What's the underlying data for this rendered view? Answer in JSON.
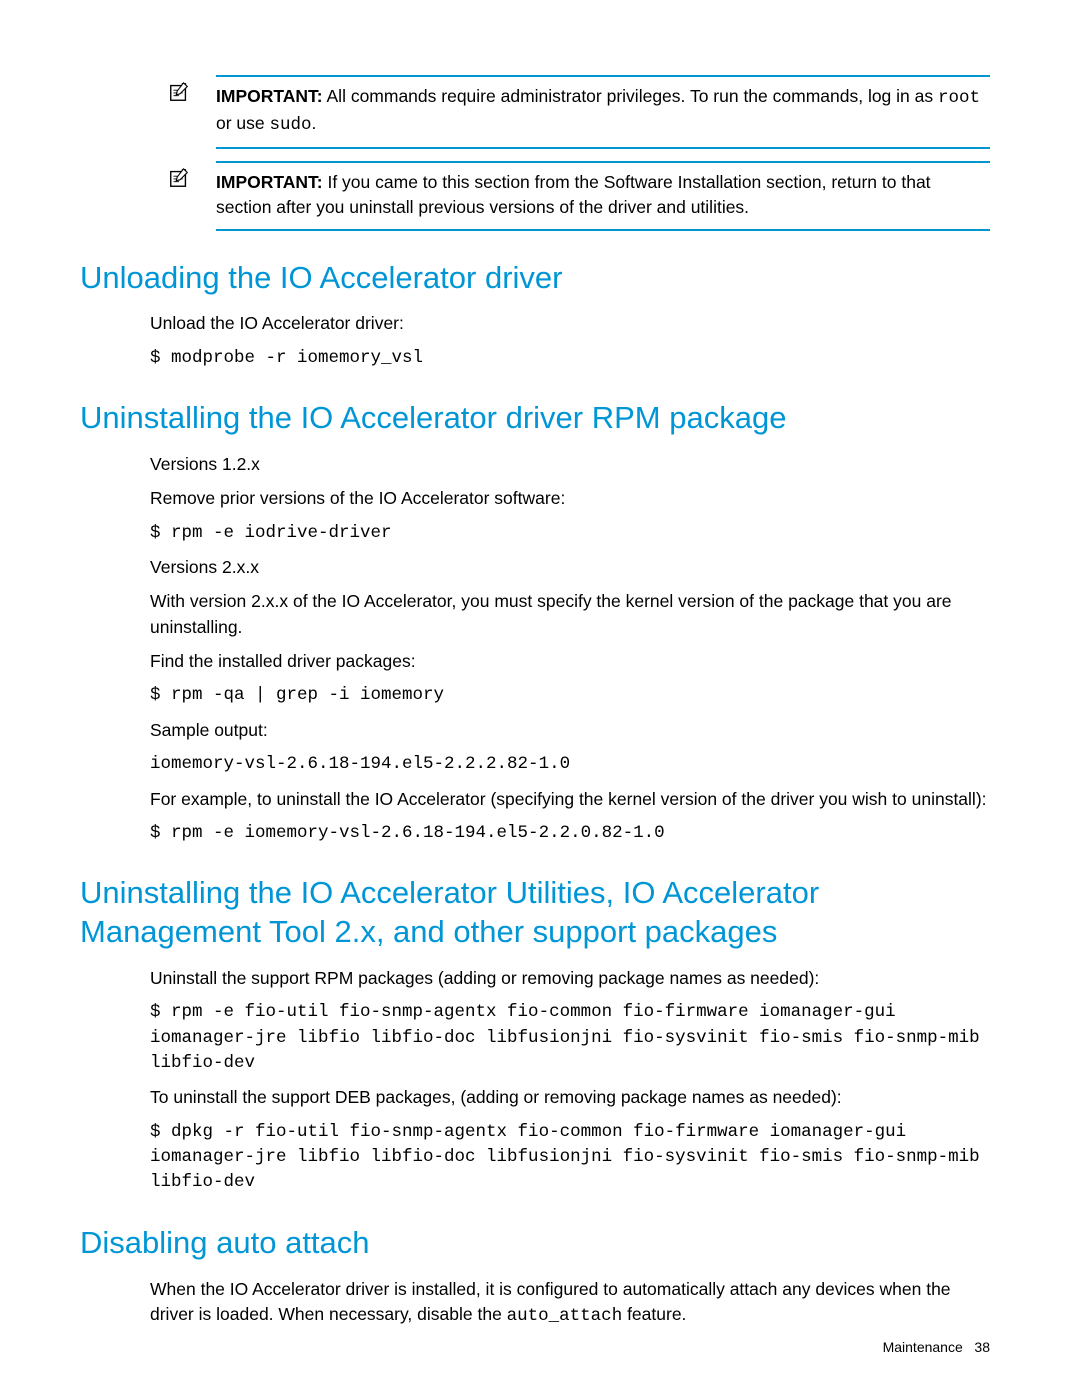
{
  "callouts": [
    {
      "label": "IMPORTANT:",
      "text_before": "  All commands require administrator privileges. To run the commands, log in as ",
      "code1": "root",
      "mid": " or use ",
      "code2": "sudo",
      "after": "."
    },
    {
      "label": "IMPORTANT:",
      "text": "  If you came to this section from the Software Installation section, return to that section after you uninstall previous versions of the driver and utilities."
    }
  ],
  "sections": {
    "unload": {
      "heading": "Unloading the IO Accelerator driver",
      "p1": "Unload the IO Accelerator driver:",
      "cmd1": "$ modprobe -r iomemory_vsl"
    },
    "uninstall_rpm": {
      "heading": "Uninstalling the IO Accelerator driver RPM package",
      "p1": "Versions 1.2.x",
      "p2": "Remove prior versions of the IO Accelerator software:",
      "cmd1": "$ rpm -e iodrive-driver",
      "p3": "Versions 2.x.x",
      "p4": "With version 2.x.x of the IO Accelerator, you must specify the kernel version of the package that you are uninstalling.",
      "p5": "Find the installed driver packages:",
      "cmd2": "$ rpm -qa | grep -i iomemory",
      "p6": "Sample output:",
      "cmd3": "iomemory-vsl-2.6.18-194.el5-2.2.2.82-1.0",
      "p7": "For example, to uninstall the IO Accelerator (specifying the kernel version of the driver you wish to uninstall):",
      "cmd4": "$ rpm -e iomemory-vsl-2.6.18-194.el5-2.2.0.82-1.0"
    },
    "uninstall_util": {
      "heading": "Uninstalling the IO Accelerator Utilities, IO Accelerator Management Tool 2.x, and other support packages",
      "p1": "Uninstall the support RPM packages (adding or removing package names as needed):",
      "cmd1": "$ rpm -e fio-util fio-snmp-agentx fio-common fio-firmware iomanager-gui iomanager-jre libfio libfio-doc libfusionjni fio-sysvinit fio-smis fio-snmp-mib libfio-dev",
      "p2": "To uninstall the support DEB packages, (adding or removing package names as needed):",
      "cmd2": "$ dpkg -r fio-util fio-snmp-agentx fio-common fio-firmware iomanager-gui iomanager-jre libfio libfio-doc libfusionjni fio-sysvinit fio-smis fio-snmp-mib libfio-dev"
    },
    "disable_auto": {
      "heading": "Disabling auto attach",
      "p1_pre": "When the IO Accelerator driver is installed, it is configured to automatically attach any devices when the driver is loaded. When necessary, disable the ",
      "code": "auto_attach",
      "p1_post": " feature."
    }
  },
  "footer": {
    "section": "Maintenance",
    "page": "38"
  }
}
